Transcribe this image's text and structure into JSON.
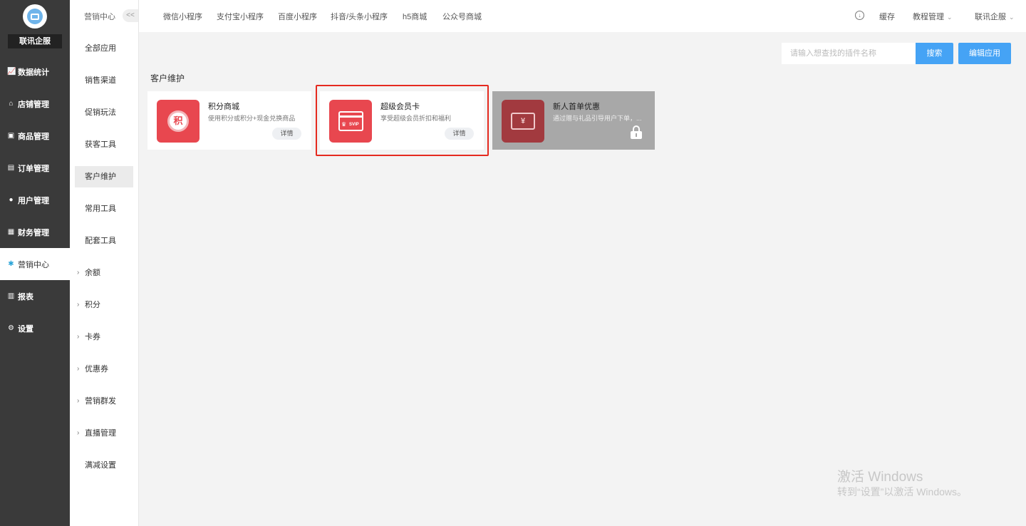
{
  "brand": {
    "name": "联讯企服"
  },
  "nav": [
    {
      "label": "数据统计",
      "icon": "chart-line-icon"
    },
    {
      "label": "店铺管理",
      "icon": "store-icon"
    },
    {
      "label": "商品管理",
      "icon": "goods-icon"
    },
    {
      "label": "订单管理",
      "icon": "order-icon"
    },
    {
      "label": "用户管理",
      "icon": "user-icon"
    },
    {
      "label": "财务管理",
      "icon": "finance-icon"
    },
    {
      "label": "营销中心",
      "icon": "marketing-icon"
    },
    {
      "label": "报表",
      "icon": "report-icon"
    },
    {
      "label": "设置",
      "icon": "gear-icon"
    }
  ],
  "subnav": {
    "header": "营销中心",
    "collapse": "<<",
    "items": [
      {
        "label": "全部应用"
      },
      {
        "label": "销售渠道"
      },
      {
        "label": "促销玩法"
      },
      {
        "label": "获客工具"
      },
      {
        "label": "客户维护"
      },
      {
        "label": "常用工具"
      },
      {
        "label": "配套工具"
      },
      {
        "label": "余额"
      },
      {
        "label": "积分"
      },
      {
        "label": "卡券"
      },
      {
        "label": "优惠券"
      },
      {
        "label": "营销群发"
      },
      {
        "label": "直播管理"
      },
      {
        "label": "满减设置"
      }
    ]
  },
  "topbar": {
    "tabs": [
      "微信小程序",
      "支付宝小程序",
      "百度小程序",
      "抖音/头条小程序",
      "h5商城",
      "公众号商城"
    ],
    "cache": "缓存",
    "tutorial": "教程管理",
    "account": "联讯企服"
  },
  "search": {
    "placeholder": "请输入想查找的插件名称",
    "button": "搜索",
    "edit": "编辑应用"
  },
  "section": {
    "title": "客户维护"
  },
  "cards": [
    {
      "title": "积分商城",
      "desc": "使用积分或积分+现金兑换商品",
      "detail": "详情",
      "glyph": "积"
    },
    {
      "title": "超级会员卡",
      "desc": "享受超级会员折扣和福利",
      "detail": "详情",
      "glyph": "SVIP"
    },
    {
      "title": "新人首单优惠",
      "desc": "通过赠与礼品引导用户下单，...",
      "glyph": "¥"
    }
  ],
  "watermark": {
    "line1": "激活 Windows",
    "line2": "转到“设置”以激活 Windows。"
  },
  "colors": {
    "accent": "#45a3f5",
    "brand_red": "#e8474f",
    "highlight": "#e52a1f"
  }
}
